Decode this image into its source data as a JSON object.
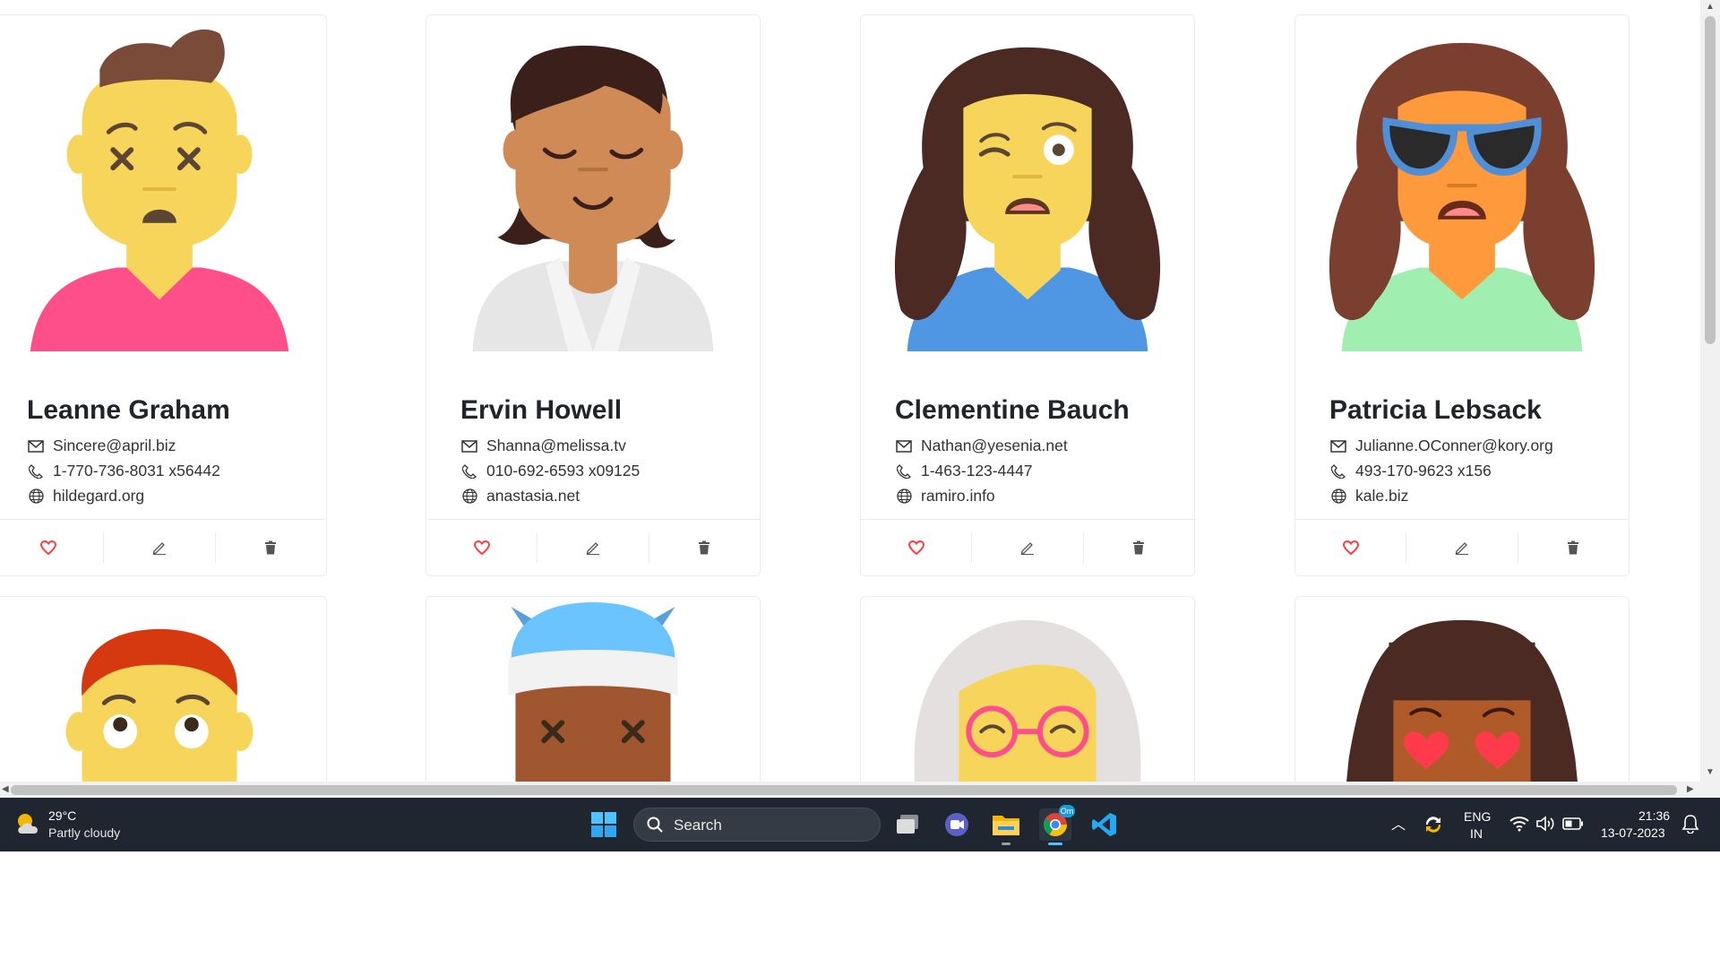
{
  "cards": [
    {
      "name": "Leanne Graham",
      "email": "Sincere@april.biz",
      "phone": "1-770-736-8031 x56442",
      "website": "hildegard.org"
    },
    {
      "name": "Ervin Howell",
      "email": "Shanna@melissa.tv",
      "phone": "010-692-6593 x09125",
      "website": "anastasia.net"
    },
    {
      "name": "Clementine Bauch",
      "email": "Nathan@yesenia.net",
      "phone": "1-463-123-4447",
      "website": "ramiro.info"
    },
    {
      "name": "Patricia Lebsack",
      "email": "Julianne.OConner@kory.org",
      "phone": "493-170-9623 x156",
      "website": "kale.biz"
    }
  ],
  "icons": {
    "email": "mail-icon",
    "phone": "phone-icon",
    "website": "globe-icon",
    "like": "heart-icon",
    "edit": "pencil-icon",
    "delete": "trash-icon"
  },
  "colors": {
    "heart": "#ff3b3b",
    "text": "#212529",
    "taskbar": "#1f2630"
  },
  "taskbar": {
    "weather_temp": "29°C",
    "weather_desc": "Partly cloudy",
    "search_label": "Search",
    "chrome_badge": "Om",
    "lang_line1": "ENG",
    "lang_line2": "IN",
    "time": "21:36",
    "date": "13-07-2023"
  }
}
